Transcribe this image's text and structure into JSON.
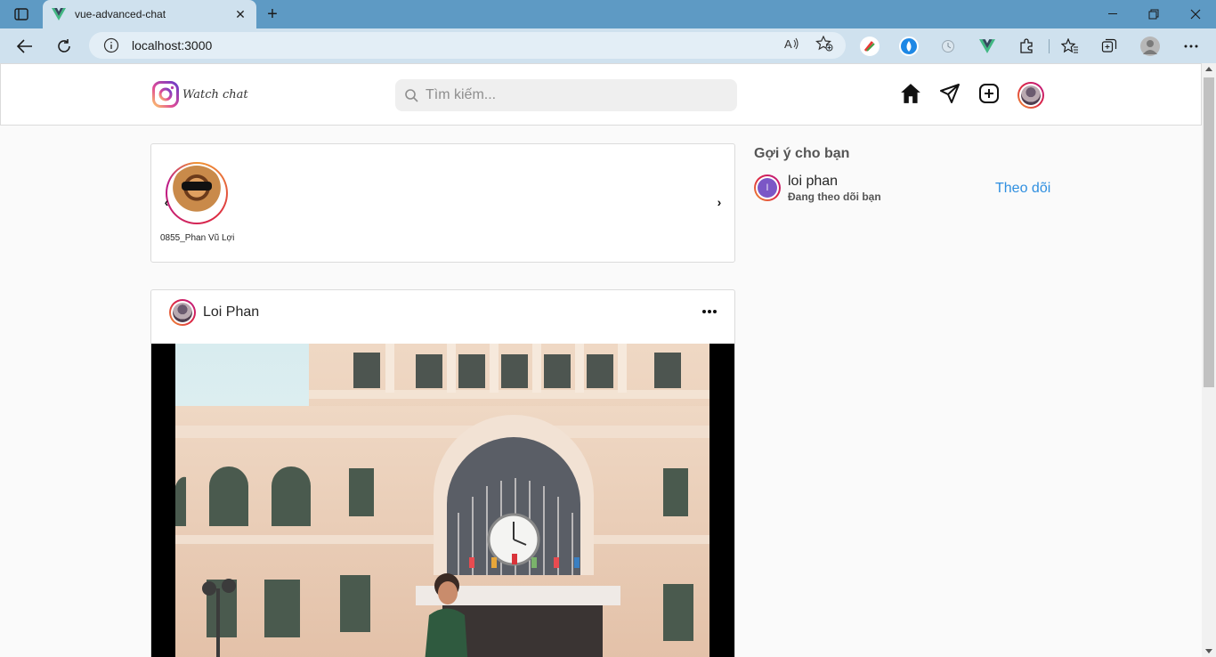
{
  "browser": {
    "tab_title": "vue-advanced-chat",
    "url": "localhost:3000",
    "colors": {
      "tabbar": "#5e9ac4",
      "toolbar": "#cfe1ee"
    }
  },
  "header": {
    "brand_text": "Watch chat",
    "search_placeholder": "Tìm kiếm..."
  },
  "stories": {
    "items": [
      {
        "name": "0855_Phan Vũ Lợi"
      }
    ]
  },
  "post": {
    "username": "Loi Phan",
    "image_subject": "building-photo"
  },
  "suggestions": {
    "title": "Gợi ý cho bạn",
    "items": [
      {
        "avatar_letter": "l",
        "name": "loi phan",
        "subtitle": "Đang theo dõi bạn",
        "action": "Theo dõi"
      }
    ]
  },
  "colors": {
    "accent": "#2f8fe0",
    "border": "#dbdbdb",
    "background": "#fafafa"
  }
}
